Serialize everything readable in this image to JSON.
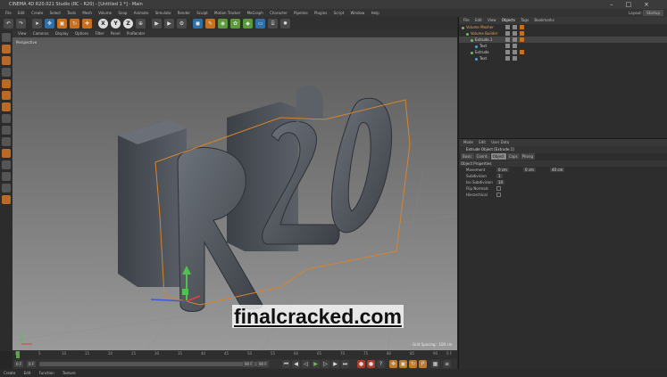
{
  "window": {
    "title": "CINEMA 4D R20.021 Studio (RC - R20) - [Untitled 1 *] - Main",
    "controls": [
      "–",
      "□",
      "×"
    ]
  },
  "menubar": {
    "items": [
      "File",
      "Edit",
      "Create",
      "Select",
      "Tools",
      "Mesh",
      "Volume",
      "Snap",
      "Animate",
      "Simulate",
      "Render",
      "Sculpt",
      "Motion Tracker",
      "MoGraph",
      "Character",
      "Pipeline",
      "Plugins",
      "Script",
      "Window",
      "Help"
    ],
    "layout_label": "Layout:",
    "layout_value": "Startup"
  },
  "toolbar": {
    "axis_x": "X",
    "axis_y": "Y",
    "axis_z": "Z"
  },
  "viewport": {
    "menu": [
      "View",
      "Cameras",
      "Display",
      "Options",
      "Filter",
      "Panel",
      "ProRender"
    ],
    "label": "Perspective",
    "grid_spacing": "Grid Spacing : 100 cm"
  },
  "watermark": "finalcracked.com",
  "timeline": {
    "ticks": [
      "0",
      "5",
      "10",
      "15",
      "20",
      "25",
      "30",
      "35",
      "40",
      "45",
      "50",
      "55",
      "60",
      "65",
      "70",
      "75",
      "80",
      "85",
      "90"
    ],
    "end_frame": "0 F"
  },
  "transport": {
    "start": "0 F",
    "current": "0 F",
    "end_a": "90 F",
    "end_b": "90 F"
  },
  "statusbar": {
    "items": [
      "Create",
      "Edit",
      "Function",
      "Texture"
    ]
  },
  "object_manager": {
    "tabs": [
      "File",
      "Edit",
      "View",
      "Objects",
      "Tags",
      "Bookmarks"
    ],
    "active_tab": "Objects",
    "objects": [
      {
        "name": "Volume Mesher",
        "indent": 0
      },
      {
        "name": "Volume Builder",
        "indent": 1
      },
      {
        "name": "Extrude.1",
        "indent": 2
      },
      {
        "name": "Text",
        "indent": 3
      },
      {
        "name": "Extrude",
        "indent": 2
      },
      {
        "name": "Text",
        "indent": 3
      }
    ]
  },
  "attribute_manager": {
    "tabs": [
      "Mode",
      "Edit",
      "User Data"
    ],
    "title": "Extrude Object [Extrude.1]",
    "subtabs": [
      "Basic",
      "Coord.",
      "Object",
      "Caps",
      "Phong"
    ],
    "selected_subtab": "Object",
    "section": "Object Properties",
    "fields": [
      {
        "label": "Movement",
        "values": [
          "0 cm",
          "0 cm",
          "40 cm"
        ]
      },
      {
        "label": "Subdivision",
        "values": [
          "1"
        ]
      },
      {
        "label": "Iso Subdivision",
        "values": [
          "10"
        ]
      },
      {
        "label": "Flip Normals",
        "values": []
      },
      {
        "label": "Hierarchical",
        "values": []
      }
    ]
  }
}
